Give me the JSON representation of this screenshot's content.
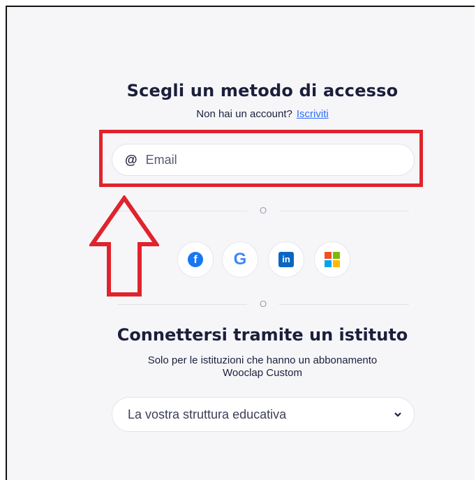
{
  "login": {
    "title": "Scegli un metodo di accesso",
    "no_account_text": "Non hai un account?",
    "signup_link": "Iscriviti",
    "email_prefix": "@",
    "email_placeholder": "Email",
    "divider_text": "O"
  },
  "social_logins": [
    {
      "name": "facebook",
      "glyph": "f",
      "color": "#1877f2"
    },
    {
      "name": "google",
      "glyph": "G",
      "color": "#4285f4"
    },
    {
      "name": "linkedin",
      "glyph": "in",
      "color": "#0a66c2"
    },
    {
      "name": "microsoft",
      "colors": [
        "#f25022",
        "#7fba00",
        "#00a4ef",
        "#ffb900"
      ]
    }
  ],
  "institution": {
    "title": "Connettersi tramite un istituto",
    "description_line1": "Solo per le istituzioni che hanno un abbonamento",
    "description_line2": "Wooclap Custom",
    "select_value": "La vostra struttura educativa"
  },
  "annotation": {
    "highlight_color": "#e0232c"
  }
}
